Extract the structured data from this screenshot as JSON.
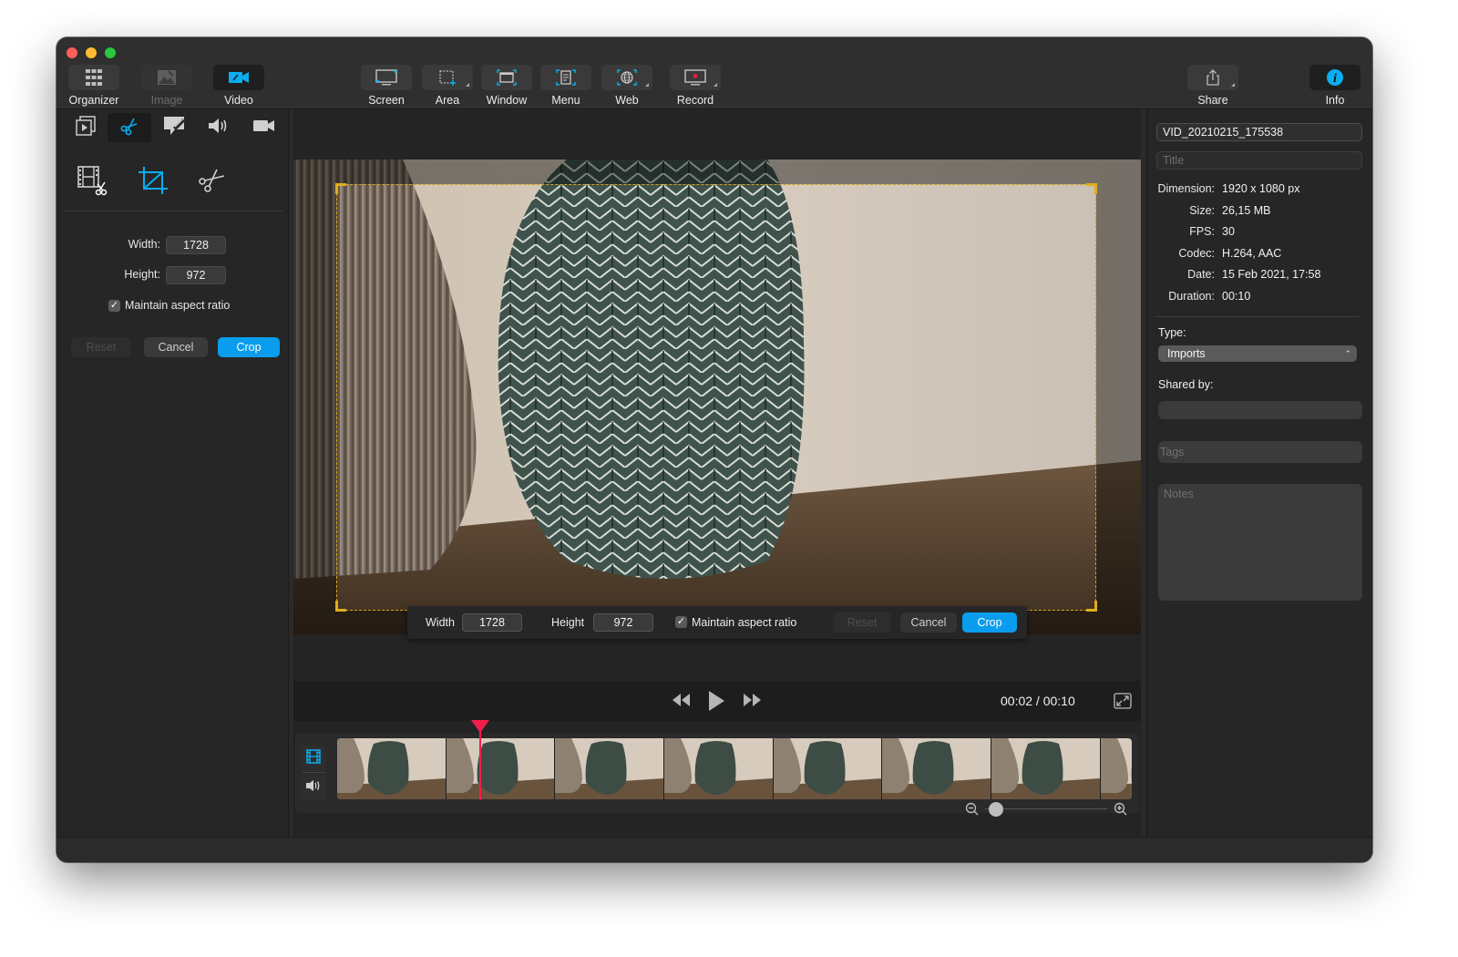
{
  "window": {
    "traffic_lights": [
      "close",
      "minimize",
      "zoom"
    ]
  },
  "toolbar": {
    "left": [
      {
        "id": "organizer",
        "label": "Organizer",
        "icon": "grid-icon",
        "state": "normal"
      },
      {
        "id": "image",
        "label": "Image",
        "icon": "image-icon",
        "state": "disabled"
      },
      {
        "id": "video",
        "label": "Video",
        "icon": "video-camera-icon",
        "state": "active"
      }
    ],
    "capture": [
      {
        "id": "screen",
        "label": "Screen",
        "icon": "screen-capture-icon"
      },
      {
        "id": "area",
        "label": "Area",
        "icon": "area-capture-icon"
      },
      {
        "id": "window",
        "label": "Window",
        "icon": "window-capture-icon"
      },
      {
        "id": "menu",
        "label": "Menu",
        "icon": "menu-capture-icon"
      },
      {
        "id": "web",
        "label": "Web",
        "icon": "web-capture-icon"
      },
      {
        "id": "record",
        "label": "Record",
        "icon": "record-icon"
      }
    ],
    "right": [
      {
        "id": "share",
        "label": "Share",
        "icon": "share-icon"
      },
      {
        "id": "info",
        "label": "Info",
        "icon": "info-icon"
      }
    ]
  },
  "left_panel": {
    "tabs": [
      {
        "id": "clips",
        "icon": "clips-icon",
        "active": false
      },
      {
        "id": "edit",
        "icon": "scissors-icon",
        "active": true
      },
      {
        "id": "annotate",
        "icon": "annotate-icon",
        "active": false
      },
      {
        "id": "audio",
        "icon": "speaker-icon",
        "active": false
      },
      {
        "id": "camera",
        "icon": "camera-icon",
        "active": false
      }
    ],
    "tools": [
      {
        "id": "trim",
        "icon": "film-trim-icon",
        "active": false
      },
      {
        "id": "crop",
        "icon": "crop-icon",
        "active": true
      },
      {
        "id": "cut",
        "icon": "cut-icon",
        "active": false
      }
    ],
    "crop_form": {
      "width_label": "Width:",
      "width_value": "1728",
      "height_label": "Height:",
      "height_value": "972",
      "maintain_label": "Maintain aspect ratio",
      "maintain_checked": true,
      "reset_label": "Reset",
      "cancel_label": "Cancel",
      "crop_label": "Crop"
    }
  },
  "crop_bar": {
    "width_label": "Width",
    "width_value": "1728",
    "height_label": "Height",
    "height_value": "972",
    "maintain_label": "Maintain aspect ratio",
    "maintain_checked": true,
    "reset_label": "Reset",
    "cancel_label": "Cancel",
    "crop_label": "Crop"
  },
  "player": {
    "current_time": "00:02",
    "duration": "00:10",
    "timecode": "00:02 / 00:10",
    "progress_fraction": 0.18,
    "thumbnail_count": 8,
    "zoom_level_fraction": 0.05
  },
  "info_panel": {
    "filename": "VID_20210215_175538",
    "title_placeholder": "Title",
    "rows": [
      {
        "key": "Dimension:",
        "value": "1920 x 1080 px"
      },
      {
        "key": "Size:",
        "value": "26,15 MB"
      },
      {
        "key": "FPS:",
        "value": "30"
      },
      {
        "key": "Codec:",
        "value": "H.264, AAC"
      },
      {
        "key": "Date:",
        "value": "15 Feb 2021, 17:58"
      },
      {
        "key": "Duration:",
        "value": "00:10"
      }
    ],
    "type_label": "Type:",
    "type_value": "Imports",
    "shared_by_label": "Shared by:",
    "shared_by_value": "",
    "tags_placeholder": "Tags",
    "notes_placeholder": "Notes"
  },
  "colors": {
    "accent": "#0a9ded",
    "playhead": "#f11e4c",
    "crop_outline": "#d4a418"
  }
}
